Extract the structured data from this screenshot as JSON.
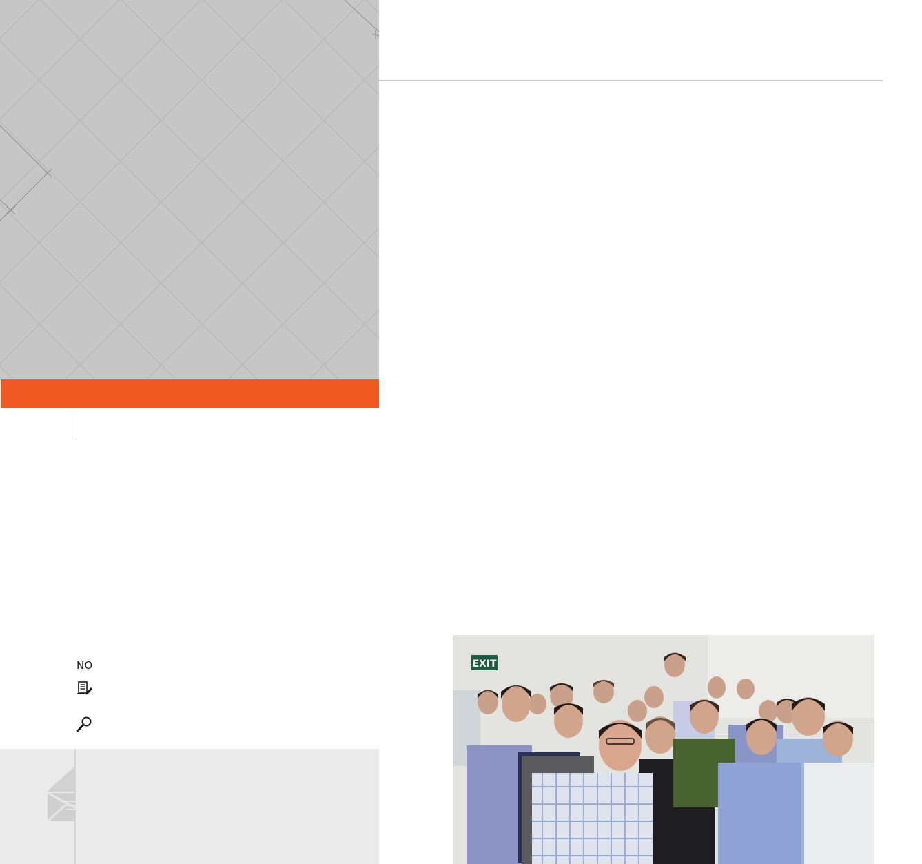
{
  "meta": {
    "number_label": "NO",
    "edit_icon": "edit-document-icon",
    "search_icon": "search-icon"
  },
  "footer": {
    "mark_icon": "envelope-mark-icon"
  },
  "photo": {
    "sign_text": "EXIT"
  },
  "colors": {
    "accent_orange": "#f05a22",
    "panel_grey": "#c6c6c6",
    "footer_grey": "#eaeaea"
  }
}
